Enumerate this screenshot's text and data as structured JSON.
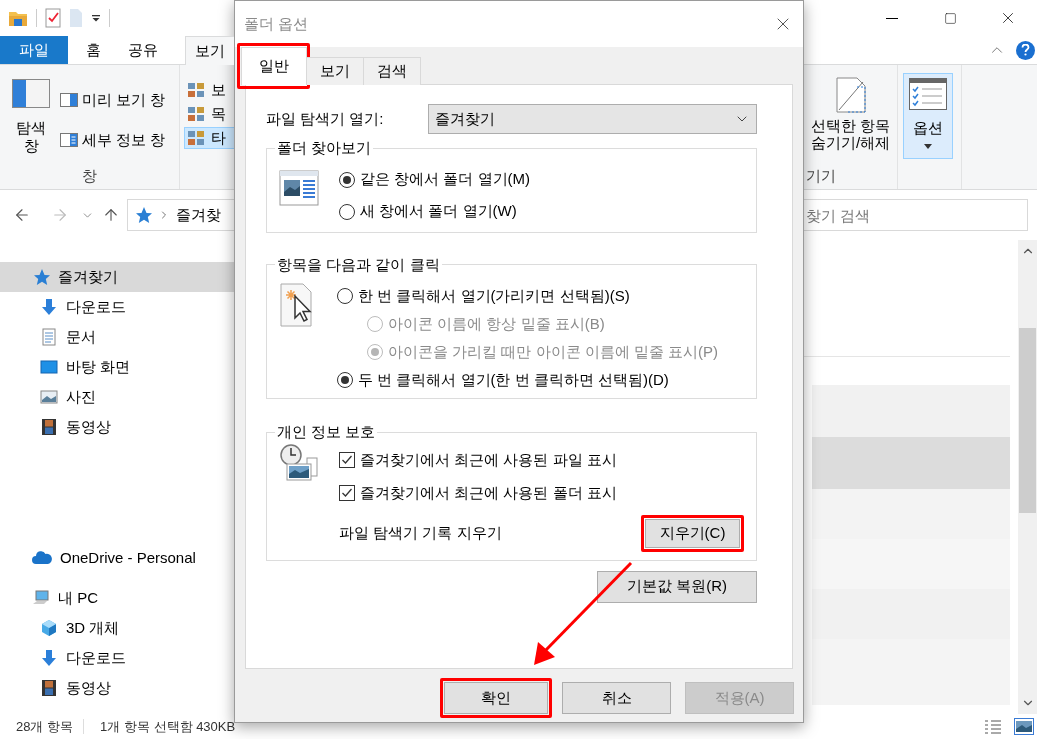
{
  "explorer": {
    "ribbon_tabs": [
      {
        "label": "파일",
        "kind": "file",
        "selected": false
      },
      {
        "label": "홈",
        "kind": "tab",
        "selected": false
      },
      {
        "label": "공유",
        "kind": "tab",
        "selected": false
      },
      {
        "label": "보기",
        "kind": "tab",
        "selected": true
      }
    ],
    "ribbon": {
      "navigation_pane": "탐색 창",
      "preview_pane": "미리 보기 창",
      "details_pane": "세부 정보 창",
      "pane_group_label": "창",
      "layout_items": [
        {
          "label": "보",
          "selected": false
        },
        {
          "label": "목",
          "selected": false
        },
        {
          "label": "타",
          "selected": true
        }
      ],
      "hide_selected": "선택한 항목 숨기기/해제",
      "show_hide_group_label": "기기",
      "options": {
        "label": "옵션",
        "selected": true
      }
    },
    "address": {
      "path": "즐겨찾",
      "search_placeholder": "찾기 검색"
    },
    "nav": [
      {
        "label": "즐겨찾기",
        "kind": "favorites",
        "selected": true,
        "children": [
          {
            "label": "다운로드",
            "kind": "download",
            "selected": false
          },
          {
            "label": "문서",
            "kind": "documents",
            "selected": false
          },
          {
            "label": "바탕 화면",
            "kind": "desktop",
            "selected": false
          },
          {
            "label": "사진",
            "kind": "pictures",
            "selected": false
          },
          {
            "label": "동영상",
            "kind": "videos",
            "selected": false
          }
        ]
      },
      {
        "label": "OneDrive - Personal",
        "kind": "cloud",
        "selected": false
      },
      {
        "label": "내 PC",
        "kind": "computer",
        "selected": false,
        "children": [
          {
            "label": "3D 개체",
            "kind": "objects3d",
            "selected": false
          },
          {
            "label": "다운로드",
            "kind": "download",
            "selected": false
          },
          {
            "label": "동영상",
            "kind": "videos",
            "selected": false
          }
        ]
      }
    ],
    "status": [
      "28개 항목",
      "1개 항목 선택함 430KB"
    ]
  },
  "dialog": {
    "title": "폴더 옵션",
    "tabs": [
      {
        "label": "일반",
        "selected": true,
        "highlighted": true
      },
      {
        "label": "보기",
        "selected": false,
        "highlighted": false
      },
      {
        "label": "검색",
        "selected": false,
        "highlighted": false
      }
    ],
    "open_explorer": {
      "label": "파일 탐색기 열기:",
      "value": "즐겨찾기"
    },
    "browse_group": {
      "title": "폴더 찾아보기",
      "options": [
        {
          "label": "같은 창에서 폴더 열기(M)",
          "selected": true,
          "disabled": false
        },
        {
          "label": "새 창에서 폴더 열기(W)",
          "selected": false,
          "disabled": false
        }
      ]
    },
    "click_group": {
      "title": "항목을 다음과 같이 클릭",
      "options": [
        {
          "label": "한 번 클릭해서 열기(가리키면 선택됨)(S)",
          "selected": false,
          "disabled": false,
          "children": [
            {
              "label": "아이콘 이름에 항상 밑줄 표시(B)",
              "selected": false,
              "disabled": true
            },
            {
              "label": "아이콘을 가리킬 때만 아이콘 이름에 밑줄 표시(P)",
              "selected": true,
              "disabled": true
            }
          ]
        },
        {
          "label": "두 번 클릭해서 열기(한 번 클릭하면 선택됨)(D)",
          "selected": true,
          "disabled": false
        }
      ]
    },
    "privacy_group": {
      "title": "개인 정보 보호",
      "checkboxes": [
        {
          "label": "즐겨찾기에서 최근에 사용된 파일 표시",
          "checked": true
        },
        {
          "label": "즐겨찾기에서 최근에 사용된 폴더 표시",
          "checked": true
        }
      ],
      "clear_label": "파일 탐색기 기록 지우기",
      "clear_button": {
        "label": "지우기(C)",
        "highlighted": true
      }
    },
    "restore_button": "기본값 복원(R)",
    "buttons": [
      {
        "label": "확인",
        "highlighted": true,
        "disabled": false
      },
      {
        "label": "취소",
        "highlighted": false,
        "disabled": false
      },
      {
        "label": "적용(A)",
        "highlighted": false,
        "disabled": true
      }
    ]
  }
}
